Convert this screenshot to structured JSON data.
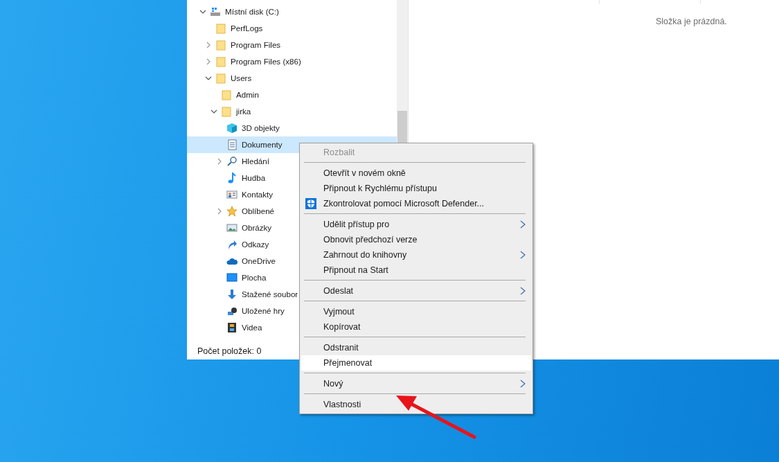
{
  "navigation_pane": {
    "tree": [
      {
        "label": "Místní disk (C:)",
        "kind": "drive",
        "expanded": true,
        "selected": false,
        "children": [
          {
            "label": "PerfLogs",
            "kind": "folder",
            "selected": false
          },
          {
            "label": "Program Files",
            "kind": "folder",
            "expanded": false,
            "selected": false
          },
          {
            "label": "Program Files (x86)",
            "kind": "folder",
            "expanded": false,
            "selected": false
          },
          {
            "label": "Users",
            "kind": "folder",
            "expanded": true,
            "selected": false,
            "children": [
              {
                "label": "Admin",
                "kind": "folder",
                "selected": false
              },
              {
                "label": "jirka",
                "kind": "folder",
                "expanded": true,
                "selected": false,
                "children": [
                  {
                    "label": "3D objekty",
                    "kind": "cube",
                    "selected": false
                  },
                  {
                    "label": "Dokumenty",
                    "kind": "document",
                    "selected": true
                  },
                  {
                    "label": "Hledání",
                    "kind": "search",
                    "expanded": false,
                    "selected": false
                  },
                  {
                    "label": "Hudba",
                    "kind": "music",
                    "selected": false
                  },
                  {
                    "label": "Kontakty",
                    "kind": "contacts",
                    "selected": false
                  },
                  {
                    "label": "Oblíbené",
                    "kind": "star",
                    "expanded": false,
                    "selected": false
                  },
                  {
                    "label": "Obrázky",
                    "kind": "pictures",
                    "selected": false
                  },
                  {
                    "label": "Odkazy",
                    "kind": "link",
                    "selected": false
                  },
                  {
                    "label": "OneDrive",
                    "kind": "cloud",
                    "selected": false
                  },
                  {
                    "label": "Plocha",
                    "kind": "desktop",
                    "selected": false
                  },
                  {
                    "label": "Stažené soubor",
                    "kind": "download",
                    "selected": false
                  },
                  {
                    "label": "Uložené hry",
                    "kind": "games",
                    "selected": false
                  },
                  {
                    "label": "Videa",
                    "kind": "video",
                    "selected": false
                  }
                ]
              }
            ]
          }
        ]
      }
    ]
  },
  "content_pane": {
    "empty_message": "Složka je prázdná."
  },
  "status_bar": {
    "item_count": "Počet položek: 0"
  },
  "context_menu": [
    {
      "kind": "item",
      "label": "Rozbalit",
      "disabled": true,
      "submenu": false,
      "selected": false
    },
    {
      "kind": "separator"
    },
    {
      "kind": "item",
      "label": "Otevřít v novém okně",
      "disabled": false,
      "submenu": false,
      "selected": false
    },
    {
      "kind": "item",
      "label": "Připnout k Rychlému přístupu",
      "disabled": false,
      "submenu": false,
      "selected": false
    },
    {
      "kind": "item",
      "label": "Zkontrolovat pomocí Microsoft Defender...",
      "disabled": false,
      "submenu": false,
      "selected": false,
      "shield": true
    },
    {
      "kind": "separator"
    },
    {
      "kind": "item",
      "label": "Udělit přístup pro",
      "disabled": false,
      "submenu": true,
      "selected": false
    },
    {
      "kind": "item",
      "label": "Obnovit předchozí verze",
      "disabled": false,
      "submenu": false,
      "selected": false
    },
    {
      "kind": "item",
      "label": "Zahrnout do knihovny",
      "disabled": false,
      "submenu": true,
      "selected": false
    },
    {
      "kind": "item",
      "label": "Připnout na Start",
      "disabled": false,
      "submenu": false,
      "selected": false
    },
    {
      "kind": "separator"
    },
    {
      "kind": "item",
      "label": "Odeslat",
      "disabled": false,
      "submenu": true,
      "selected": false
    },
    {
      "kind": "separator"
    },
    {
      "kind": "item",
      "label": "Vyjmout",
      "disabled": false,
      "submenu": false,
      "selected": false
    },
    {
      "kind": "item",
      "label": "Kopírovat",
      "disabled": false,
      "submenu": false,
      "selected": false
    },
    {
      "kind": "separator"
    },
    {
      "kind": "item",
      "label": "Odstranit",
      "disabled": false,
      "submenu": false,
      "selected": false
    },
    {
      "kind": "item",
      "label": "Přejmenovat",
      "disabled": false,
      "submenu": false,
      "selected": true
    },
    {
      "kind": "separator"
    },
    {
      "kind": "item",
      "label": "Nový",
      "disabled": false,
      "submenu": true,
      "selected": false
    },
    {
      "kind": "separator"
    },
    {
      "kind": "item",
      "label": "Vlastnosti",
      "disabled": false,
      "submenu": false,
      "selected": false
    }
  ]
}
